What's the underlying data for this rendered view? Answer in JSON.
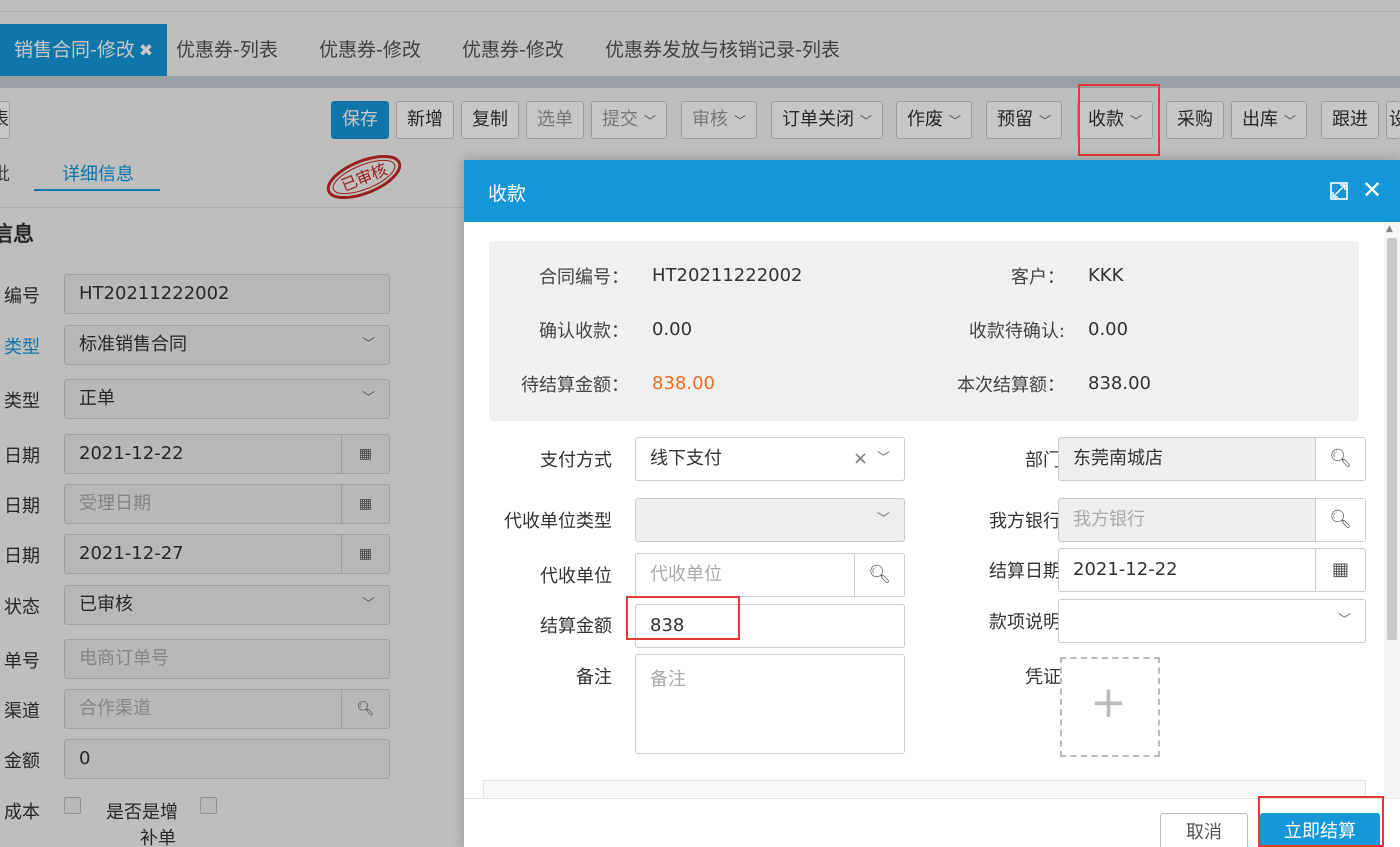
{
  "tabs": [
    {
      "label": "销售合同-修改",
      "close": "✖"
    },
    {
      "label": "优惠券-列表"
    },
    {
      "label": "优惠券-修改"
    },
    {
      "label": "优惠券-修改"
    },
    {
      "label": "优惠券发放与核销记录-列表"
    }
  ],
  "toolbar": {
    "left_cut": "表",
    "buttons": [
      "保存",
      "新增",
      "复制",
      "选单",
      "提交",
      "审核",
      "订单关闭",
      "作废",
      "预留",
      "收款",
      "采购",
      "出库",
      "跟进",
      "设"
    ]
  },
  "subtabs": {
    "left_cut": "批",
    "detail": "详细信息"
  },
  "stamp": {
    "text": "已审核"
  },
  "section_title": "信息",
  "form": [
    {
      "label": "编号",
      "value": "HT20211222002"
    },
    {
      "label": "类型",
      "value": "标准销售合同"
    },
    {
      "label": "类型",
      "value": "正单"
    },
    {
      "label": "日期",
      "value": "2021-12-22"
    },
    {
      "label": "日期",
      "value": "受理日期"
    },
    {
      "label": "日期",
      "value": "2021-12-27"
    },
    {
      "label": "状态",
      "value": "已审核"
    },
    {
      "label": "单号",
      "value": "电商订单号"
    },
    {
      "label": "渠道",
      "value": "合作渠道"
    },
    {
      "label": "金额",
      "value": "0"
    },
    {
      "label": "成本",
      "value": ""
    }
  ],
  "form_extra": {
    "increase_label_1": "是否是增",
    "increase_label_2": "补单"
  },
  "modal": {
    "title": "收款",
    "summary": {
      "contract_no_label": "合同编号：",
      "contract_no": "HT20211222002",
      "customer_label": "客户：",
      "customer": "KKK",
      "confirmed_label": "确认收款：",
      "confirmed": "0.00",
      "pending_confirm_label": "收款待确认:",
      "pending_confirm": "0.00",
      "to_settle_label": "待结算金额：",
      "to_settle": "838.00",
      "this_settle_label": "本次结算额：",
      "this_settle": "838.00"
    },
    "fields": {
      "pay_method_label": "支付方式",
      "pay_method": "线下支付",
      "dept_label": "部门",
      "dept": "东莞南城店",
      "agent_type_label": "代收单位类型",
      "agent_type": "",
      "our_bank_label": "我方银行",
      "our_bank_placeholder": "我方银行",
      "agent_label": "代收单位",
      "agent_placeholder": "代收单位",
      "settle_date_label": "结算日期",
      "settle_date": "2021-12-22",
      "settle_amount_label": "结算金额",
      "settle_amount": "838",
      "desc_label": "款项说明",
      "desc": "",
      "remark_label": "备注",
      "remark_placeholder": "备注",
      "voucher_label": "凭证"
    },
    "footer": {
      "cancel": "取消",
      "settle": "立即结算"
    }
  },
  "colors": {
    "primary": "#1597d8",
    "orange": "#f06b1f",
    "highlight": "#e53935"
  }
}
